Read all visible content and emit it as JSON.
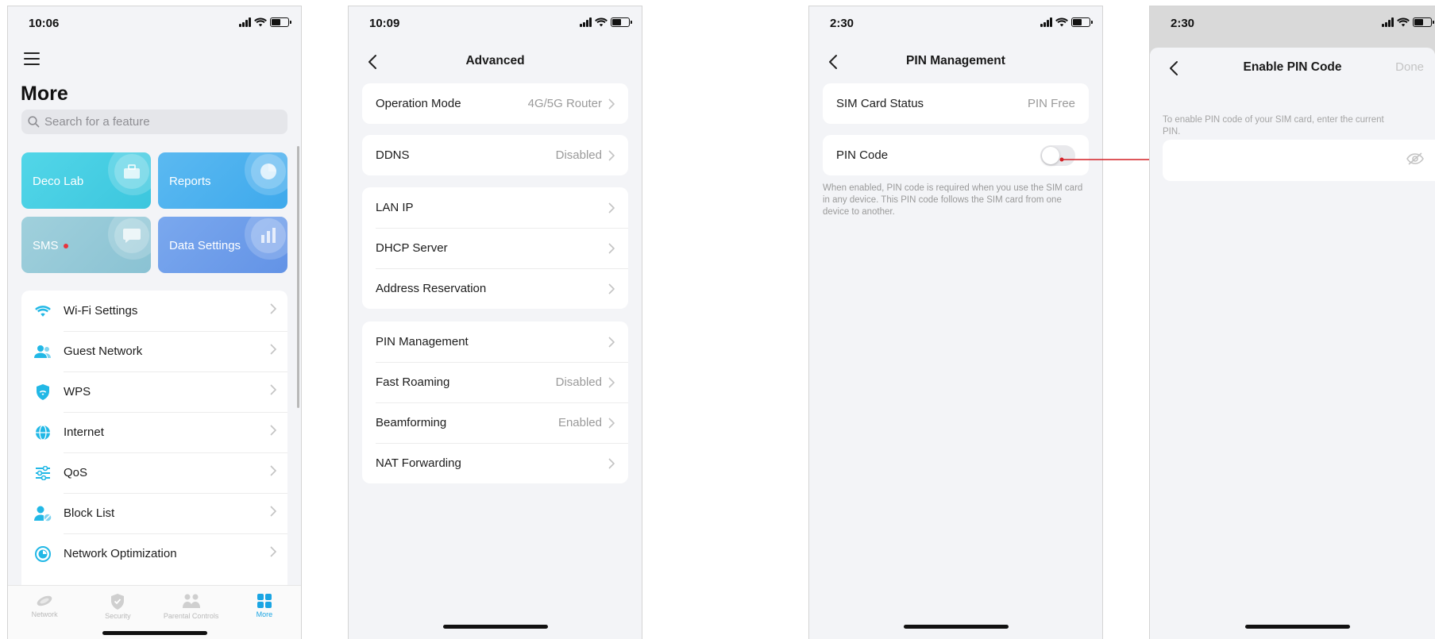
{
  "colors": {
    "accent": "#1aa5e3",
    "tile_deco_lab": "#4fd3e6",
    "tile_reports": "#4fb3ef",
    "tile_sms": "#96c9d8",
    "tile_data_settings": "#6f9fea",
    "arrow": "#d42026",
    "red_dot": "#e8333d"
  },
  "screen1": {
    "status_time": "10:06",
    "page_title": "More",
    "search_placeholder": "Search for a feature",
    "tiles": [
      {
        "label": "Deco Lab",
        "icon": "briefcase-icon"
      },
      {
        "label": "Reports",
        "icon": "pie-chart-icon"
      },
      {
        "label": "SMS",
        "icon": "chat-bubble-icon",
        "has_badge": true
      },
      {
        "label": "Data Settings",
        "icon": "bar-chart-icon"
      }
    ],
    "menu": [
      {
        "label": "Wi-Fi Settings",
        "icon": "wifi-icon"
      },
      {
        "label": "Guest Network",
        "icon": "guest-users-icon"
      },
      {
        "label": "WPS",
        "icon": "shield-wifi-icon"
      },
      {
        "label": "Internet",
        "icon": "globe-icon"
      },
      {
        "label": "QoS",
        "icon": "sliders-icon"
      },
      {
        "label": "Block List",
        "icon": "block-user-icon"
      },
      {
        "label": "Network Optimization",
        "icon": "optimization-icon"
      }
    ],
    "tabs": [
      {
        "label": "Network",
        "icon": "network-icon"
      },
      {
        "label": "Security",
        "icon": "shield-icon"
      },
      {
        "label": "Parental Controls",
        "icon": "family-icon"
      },
      {
        "label": "More",
        "icon": "grid-icon",
        "active": true
      }
    ]
  },
  "screen2": {
    "status_time": "10:09",
    "title": "Advanced",
    "group1": [
      {
        "label": "Operation Mode",
        "value": "4G/5G Router"
      }
    ],
    "group2": [
      {
        "label": "DDNS",
        "value": "Disabled"
      }
    ],
    "group3": [
      {
        "label": "LAN IP",
        "value": ""
      },
      {
        "label": "DHCP Server",
        "value": ""
      },
      {
        "label": "Address Reservation",
        "value": ""
      }
    ],
    "group4": [
      {
        "label": "PIN Management",
        "value": ""
      },
      {
        "label": "Fast Roaming",
        "value": "Disabled"
      },
      {
        "label": "Beamforming",
        "value": "Enabled"
      },
      {
        "label": "NAT Forwarding",
        "value": ""
      }
    ]
  },
  "screen3": {
    "status_time": "2:30",
    "title": "PIN Management",
    "sim_status_label": "SIM Card Status",
    "sim_status_value": "PIN Free",
    "pin_code_label": "PIN Code",
    "pin_code_enabled": false,
    "hint": "When enabled, PIN code is required when you use the SIM card in any device. This PIN code follows the SIM card from one device to another."
  },
  "screen4": {
    "status_time": "2:30",
    "title": "Enable PIN Code",
    "done_label": "Done",
    "instruction": "To enable PIN code of your SIM card, enter the current PIN.",
    "pin_value": ""
  }
}
